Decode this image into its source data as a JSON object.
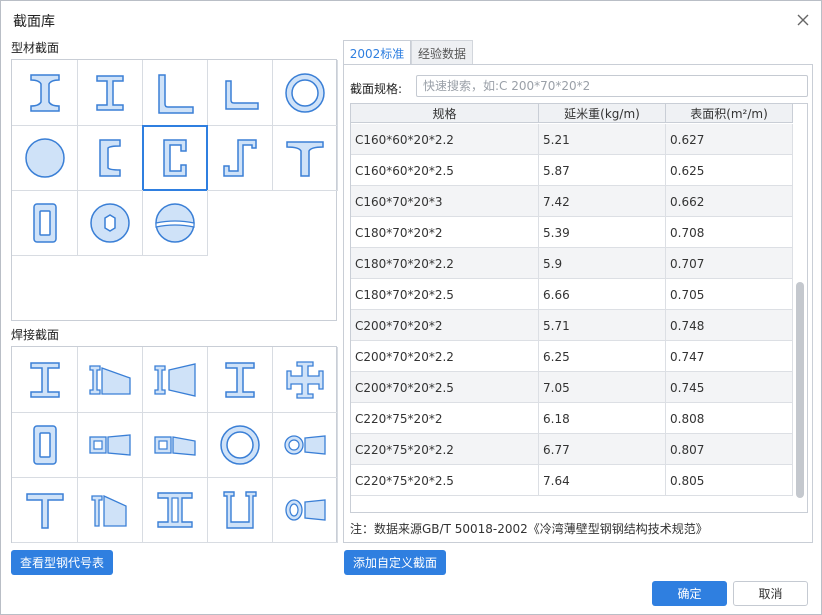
{
  "dialog": {
    "title": "截面库"
  },
  "left": {
    "profile_label": "型材截面",
    "welded_label": "焊接截面",
    "profile_icons": [
      "i-beam-icon",
      "h-beam-icon",
      "equal-angle-icon",
      "unequal-angle-icon",
      "pipe-icon",
      "round-bar-icon",
      "channel-icon",
      "c-section-icon",
      "z-section-icon",
      "t-section-icon",
      "rect-tube-icon",
      "hex-nut-icon",
      "sphere-icon"
    ],
    "welded_icons": [
      "welded-i-icon",
      "tapered-i-icon",
      "tapered-h-icon",
      "welded-h-icon",
      "cross-section-icon",
      "welded-box-icon",
      "tapered-box-icon",
      "tapered-box-slope-icon",
      "welded-pipe-icon",
      "tapered-pipe-icon",
      "welded-t-icon",
      "tapered-t-icon",
      "double-i-icon",
      "u-section-icon",
      "tapered-ellipse-icon"
    ],
    "view_codes_button": "查看型钢代号表"
  },
  "right": {
    "tabs": [
      {
        "label": "2002标准"
      },
      {
        "label": "经验数据"
      }
    ],
    "search_label": "截面规格:",
    "search_placeholder": "快速搜索，如:C 200*70*20*2",
    "columns": [
      "规格",
      "延米重(kg/m)",
      "表面积(m²/m)"
    ],
    "rows": [
      [
        "C160*60*20*2.2",
        "5.21",
        "0.627"
      ],
      [
        "C160*60*20*2.5",
        "5.87",
        "0.625"
      ],
      [
        "C160*70*20*3",
        "7.42",
        "0.662"
      ],
      [
        "C180*70*20*2",
        "5.39",
        "0.708"
      ],
      [
        "C180*70*20*2.2",
        "5.9",
        "0.707"
      ],
      [
        "C180*70*20*2.5",
        "6.66",
        "0.705"
      ],
      [
        "C200*70*20*2",
        "5.71",
        "0.748"
      ],
      [
        "C200*70*20*2.2",
        "6.25",
        "0.747"
      ],
      [
        "C200*70*20*2.5",
        "7.05",
        "0.745"
      ],
      [
        "C220*75*20*2",
        "6.18",
        "0.808"
      ],
      [
        "C220*75*20*2.2",
        "6.77",
        "0.807"
      ],
      [
        "C220*75*20*2.5",
        "7.64",
        "0.805"
      ]
    ],
    "note": "注：数据来源GB/T 50018-2002《冷湾薄壁型钢钢结构技术规范》",
    "add_custom_button": "添加自定义截面"
  },
  "footer": {
    "ok": "确定",
    "cancel": "取消"
  },
  "colors": {
    "accent": "#2f7fe0",
    "icon_fill": "#cfe2f8",
    "icon_stroke": "#3a7fd6"
  }
}
